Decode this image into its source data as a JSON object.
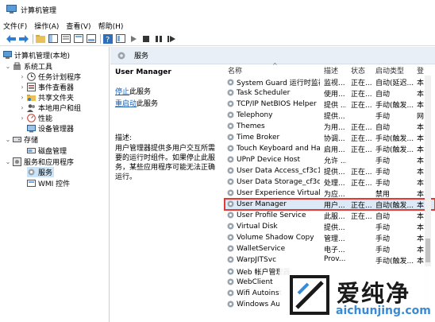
{
  "window": {
    "title": "计算机管理"
  },
  "menu": [
    "文件(F)",
    "操作(A)",
    "查看(V)",
    "帮助(H)"
  ],
  "tree": {
    "root": "计算机管理(本地)",
    "items": [
      {
        "label": "系统工具",
        "level": 1,
        "expanded": true
      },
      {
        "label": "任务计划程序",
        "level": 2
      },
      {
        "label": "事件查看器",
        "level": 2
      },
      {
        "label": "共享文件夹",
        "level": 2
      },
      {
        "label": "本地用户和组",
        "level": 2
      },
      {
        "label": "性能",
        "level": 2
      },
      {
        "label": "设备管理器",
        "level": 2
      },
      {
        "label": "存储",
        "level": 1,
        "expanded": true
      },
      {
        "label": "磁盘管理",
        "level": 2
      },
      {
        "label": "服务和应用程序",
        "level": 1,
        "expanded": true
      },
      {
        "label": "服务",
        "level": 2,
        "selected": true
      },
      {
        "label": "WMI 控件",
        "level": 2
      }
    ]
  },
  "pane": {
    "title": "服务"
  },
  "detail": {
    "service_name": "User Manager",
    "stop_link": "停止",
    "stop_rest": "此服务",
    "restart_link": "重启动",
    "restart_rest": "此服务",
    "desc_label": "描述:",
    "desc_text": "用户管理器提供多用户交互所需要的运行时组件。如果停止此服务，某些应用程序可能无法正确运行。"
  },
  "list": {
    "headers": {
      "name": "名称",
      "desc": "描述",
      "status": "状态",
      "startup": "启动类型",
      "logon": "登"
    },
    "rows": [
      {
        "name": "System Guard 运行时监视...",
        "desc": "监视...",
        "status": "正在...",
        "startup": "自动(延迟...",
        "logon": "本"
      },
      {
        "name": "Task Scheduler",
        "desc": "使用...",
        "status": "正在...",
        "startup": "自动",
        "logon": "本"
      },
      {
        "name": "TCP/IP NetBIOS Helper",
        "desc": "提供 ...",
        "status": "正在...",
        "startup": "手动(触发...",
        "logon": "本"
      },
      {
        "name": "Telephony",
        "desc": "提供...",
        "status": "",
        "startup": "手动",
        "logon": "网"
      },
      {
        "name": "Themes",
        "desc": "为用...",
        "status": "正在...",
        "startup": "自动",
        "logon": "本"
      },
      {
        "name": "Time Broker",
        "desc": "协调...",
        "status": "正在...",
        "startup": "手动(触发...",
        "logon": "本"
      },
      {
        "name": "Touch Keyboard and Ha...",
        "desc": "启用...",
        "status": "正在...",
        "startup": "手动(触发...",
        "logon": "本"
      },
      {
        "name": "UPnP Device Host",
        "desc": "允许 ...",
        "status": "",
        "startup": "手动",
        "logon": "本"
      },
      {
        "name": "User Data Access_cf3c1d6",
        "desc": "提供...",
        "status": "正在...",
        "startup": "手动",
        "logon": "本"
      },
      {
        "name": "User Data Storage_cf3c1...",
        "desc": "处理...",
        "status": "正在...",
        "startup": "手动",
        "logon": "本"
      },
      {
        "name": "User Experience Virtuali...",
        "desc": "为应...",
        "status": "",
        "startup": "禁用",
        "logon": "本"
      },
      {
        "name": "User Manager",
        "desc": "用户...",
        "status": "正在...",
        "startup": "自动(触发...",
        "logon": "本",
        "highlighted": true
      },
      {
        "name": "User Profile Service",
        "desc": "此服...",
        "status": "正在...",
        "startup": "自动",
        "logon": "本"
      },
      {
        "name": "Virtual Disk",
        "desc": "提供...",
        "status": "",
        "startup": "手动",
        "logon": "本"
      },
      {
        "name": "Volume Shadow Copy",
        "desc": "管理...",
        "status": "",
        "startup": "手动",
        "logon": "本"
      },
      {
        "name": "WalletService",
        "desc": "电子...",
        "status": "",
        "startup": "手动",
        "logon": "本"
      },
      {
        "name": "WarpJITSvc",
        "desc": "Prov...",
        "status": "",
        "startup": "手动(触发...",
        "logon": "本"
      },
      {
        "name": "Web 帐户管理器",
        "desc": "",
        "status": "",
        "startup": "",
        "logon": ""
      },
      {
        "name": "WebClient",
        "desc": "",
        "status": "",
        "startup": "",
        "logon": ""
      },
      {
        "name": "Wifi Autoinst",
        "desc": "",
        "status": "",
        "startup": "",
        "logon": ""
      },
      {
        "name": "Windows Au",
        "desc": "",
        "status": "",
        "startup": "",
        "logon": ""
      }
    ]
  },
  "watermark": {
    "text": "爱纯净",
    "url": "aichunjing.com"
  },
  "colors": {
    "highlight_border": "#e53935",
    "selection": "#cce4f7",
    "link": "#1a5fb4",
    "pane_header": "#e9eff6"
  }
}
